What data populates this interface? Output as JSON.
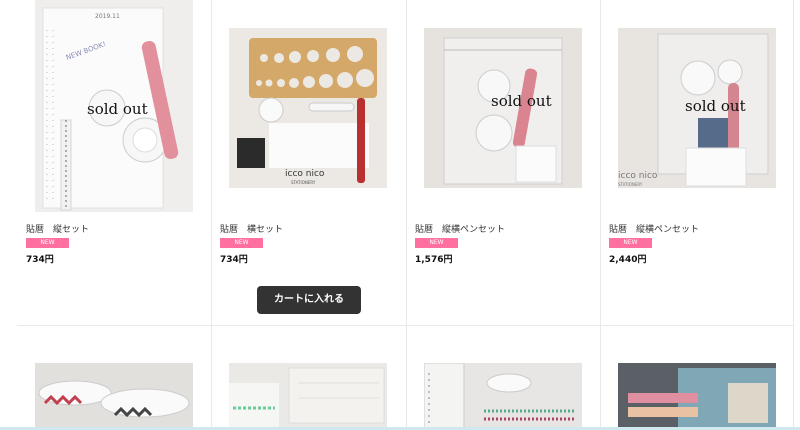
{
  "products": [
    {
      "title": "貼暦　縦セット",
      "badge": "NEW",
      "price": "734円",
      "overlay": "sold out"
    },
    {
      "title": "貼暦　横セット",
      "badge": "NEW",
      "price": "734円"
    },
    {
      "title": "貼暦　縦横ペンセット",
      "badge": "NEW",
      "price": "1,576円",
      "overlay": "sold out"
    },
    {
      "title": "貼暦　縦横ペンセット",
      "badge": "NEW",
      "price": "2,440円",
      "overlay": "sold out"
    }
  ],
  "cart_button_label": "カートに入れる",
  "image_text": {
    "handwriting_1": "2019.11",
    "handwriting_2": "NEW BOOK!",
    "brand": "icco nico",
    "brand_sub": "STATIONERY"
  }
}
